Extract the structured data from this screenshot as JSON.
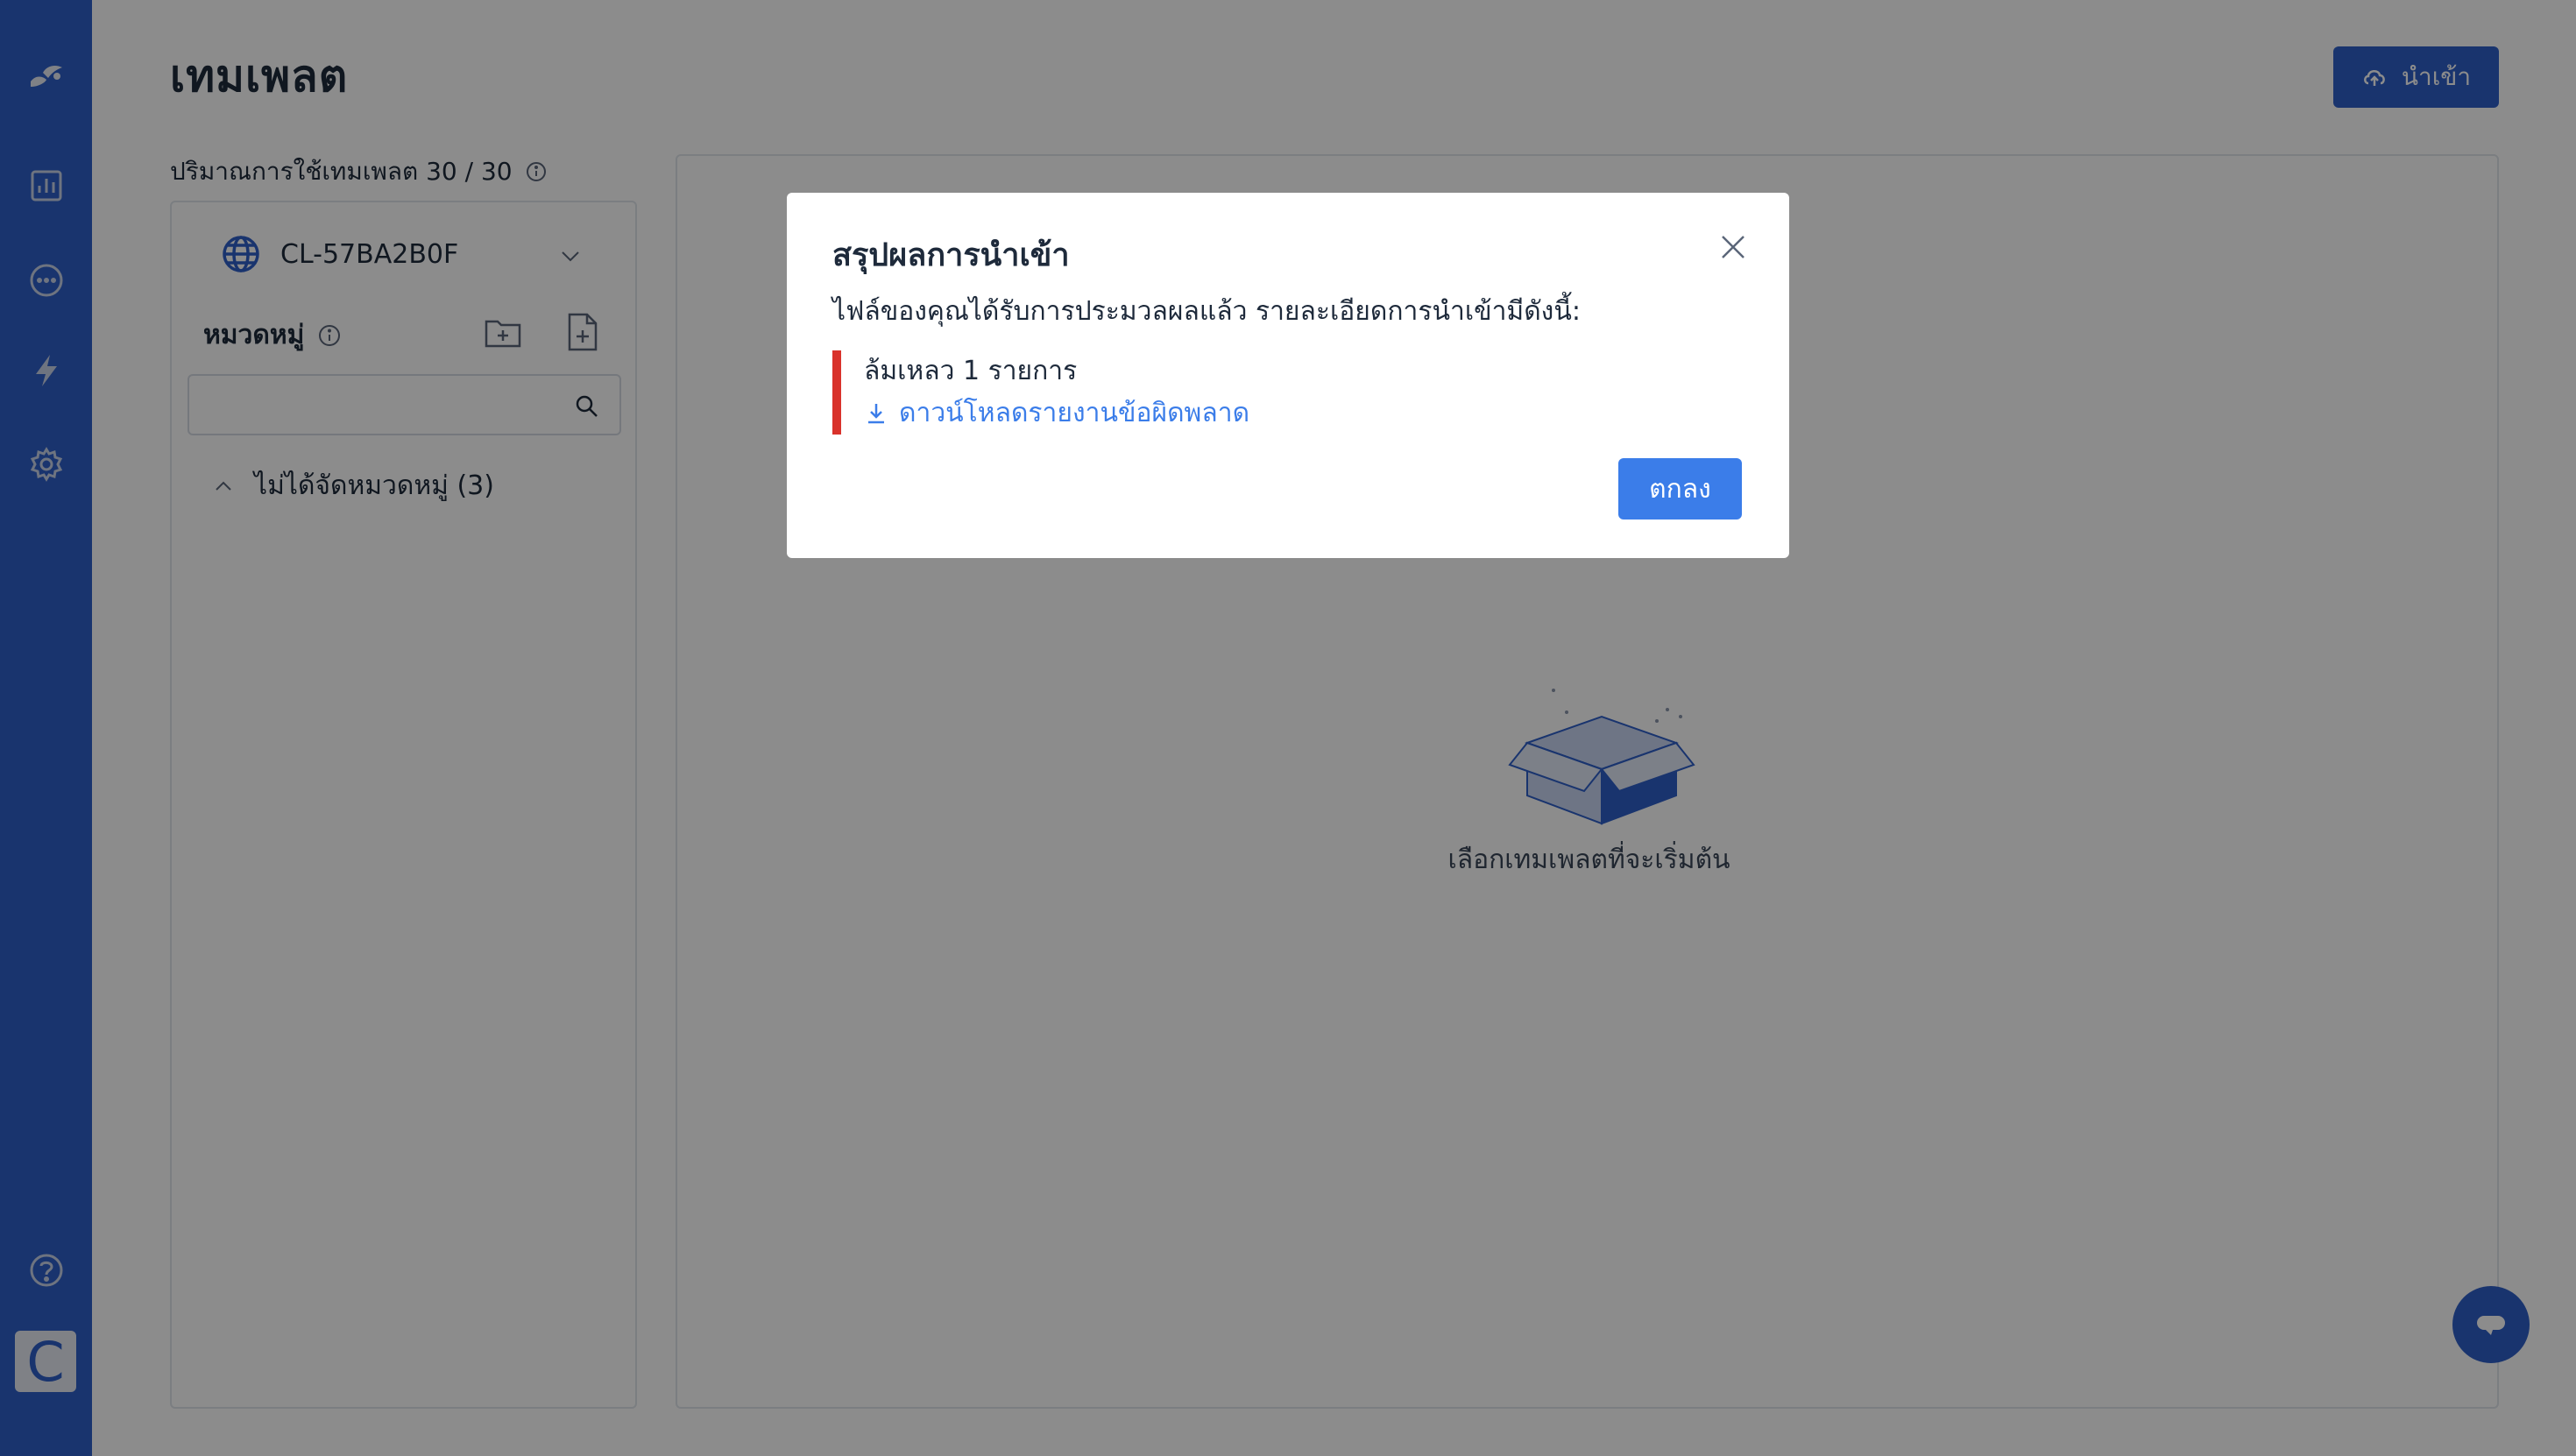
{
  "colors": {
    "brand": "#2f5fc8",
    "accent": "#3b7de9",
    "error": "#d9322b",
    "overlay": "rgba(0,0,0,0.45)"
  },
  "sidebar": {
    "items": [
      {
        "icon": "logo-icon"
      },
      {
        "icon": "analytics-icon"
      },
      {
        "icon": "chat-icon"
      },
      {
        "icon": "bolt-icon"
      },
      {
        "icon": "gear-icon"
      },
      {
        "icon": "help-icon"
      }
    ],
    "avatar_letter": "C"
  },
  "header": {
    "title": "เทมเพลต",
    "import_label": "นำเข้า"
  },
  "usage": {
    "text": "ปริมาณการใช้เทมเพลต 30 / 30"
  },
  "left_panel": {
    "tenant": "CL-57BA2B0F",
    "category_label": "หมวดหมู่",
    "search_placeholder": "",
    "group_label": "ไม่ได้จัดหมวดหมู่ (3)"
  },
  "main_panel": {
    "empty_text": "เลือกเทมเพลตที่จะเริ่มต้น"
  },
  "modal": {
    "title": "สรุปผลการนำเข้า",
    "description": "ไฟล์ของคุณได้รับการประมวลผลแล้ว รายละเอียดการนำเข้ามีดังนี้:",
    "fail_text": "ล้มเหลว 1 รายการ",
    "download_link": "ดาวน์โหลดรายงานข้อผิดพลาด",
    "ok_label": "ตกลง"
  }
}
